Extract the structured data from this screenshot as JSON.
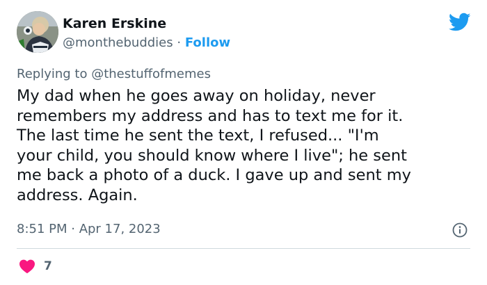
{
  "author": {
    "name": "Karen Erskine",
    "handle": "@monthebuddies",
    "separator": "·",
    "follow_label": "Follow"
  },
  "reply": {
    "prefix": "Replying to",
    "handle": "@thestuffofmemes"
  },
  "tweet": {
    "text_lines": [
      "My dad when he goes away on holiday, never",
      "remembers my address and has to text me for it.",
      "The last time he sent the text, I refused... \"I'm",
      "your child, you should know where I live\"; he sent",
      "me back a photo of a duck. I gave up and sent my",
      "address. Again."
    ],
    "timestamp": "8:51 PM · Apr 17, 2023"
  },
  "engagement": {
    "likes": "7"
  },
  "colors": {
    "accent": "#1d9bf0",
    "like": "#f91880",
    "secondary_text": "#536471",
    "primary_text": "#0f1419"
  },
  "icons": {
    "brand": "twitter-bird-icon",
    "info": "info-icon",
    "like": "heart-icon"
  }
}
